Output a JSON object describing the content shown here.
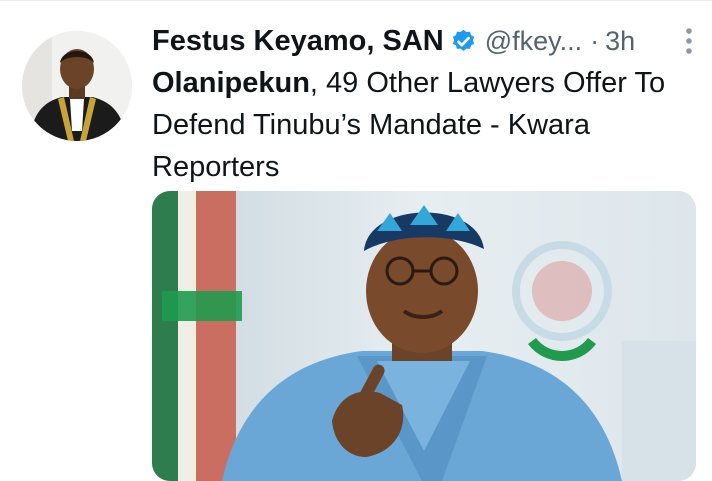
{
  "tweet": {
    "author_name": "Festus Keyamo, SAN",
    "author_handle": "@fkey...",
    "separator": "·",
    "time": "3h",
    "text_bold": "Olanipekun",
    "text_rest": ", 49 Other Lawyers Offer To Defend Tinubu’s Mandate - Kwara Reporters",
    "verified": true
  },
  "icons": {
    "verified": "verified-badge-icon",
    "more": "more-vertical-icon"
  },
  "colors": {
    "verified_blue": "#1d9bf0",
    "text_primary": "#0f1419",
    "text_secondary": "#536471",
    "cap_navy": "#173a64",
    "cap_blue": "#33a8d8",
    "agbada_blue": "#6aa6d6",
    "flag_green": "#1f9a4f",
    "flag_red": "#d23c2e"
  }
}
